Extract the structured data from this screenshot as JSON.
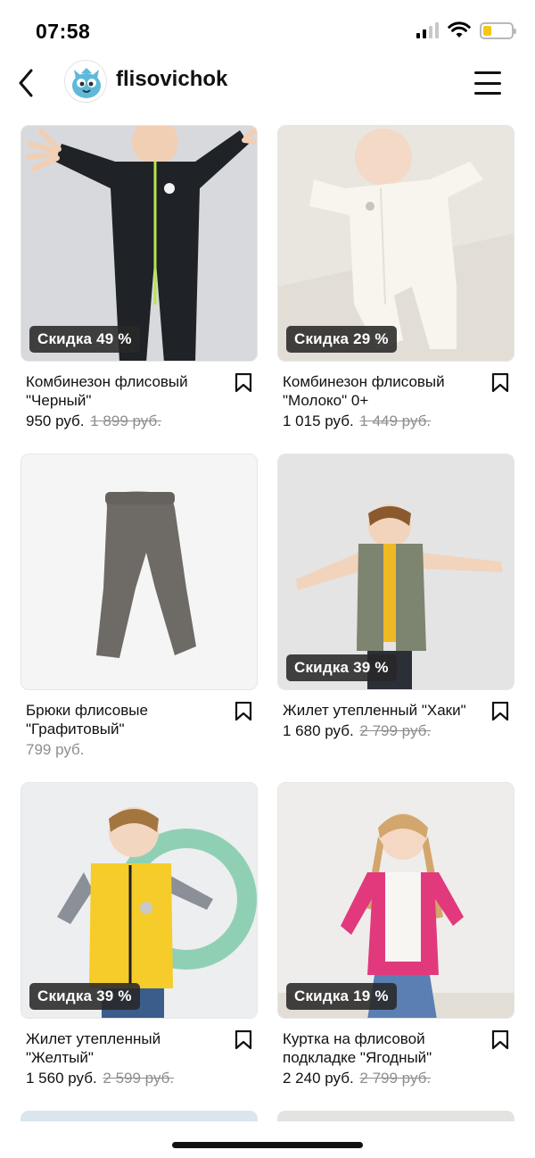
{
  "status": {
    "time": "07:58"
  },
  "header": {
    "username": "flisovichok"
  },
  "products": [
    {
      "name": "Комбинезон флисовый \"Черный\"",
      "price": "950 руб.",
      "old_price": "1 899 руб.",
      "discount": "Скидка 49 %"
    },
    {
      "name": "Комбинезон флисовый \"Молоко\" 0+",
      "price": "1 015 руб.",
      "old_price": "1 449 руб.",
      "discount": "Скидка 29 %"
    },
    {
      "name": "Брюки флисовые \"Графитовый\"",
      "price": "799 руб.",
      "old_price": "",
      "discount": ""
    },
    {
      "name": "Жилет утепленный \"Хаки\"",
      "price": "1 680 руб.",
      "old_price": "2 799 руб.",
      "discount": "Скидка 39 %"
    },
    {
      "name": "Жилет утепленный \"Желтый\"",
      "price": "1 560 руб.",
      "old_price": "2 599 руб.",
      "discount": "Скидка 39 %"
    },
    {
      "name": "Куртка на флисовой подкладке \"Ягодный\"",
      "price": "2 240 руб.",
      "old_price": "2 799 руб.",
      "discount": "Скидка 19 %"
    }
  ],
  "icons": {
    "back": "chevron-left-icon",
    "menu": "hamburger-menu-icon",
    "bookmark": "bookmark-icon",
    "wifi": "wifi-icon",
    "battery": "battery-icon",
    "signal": "signal-icon"
  },
  "colors": {
    "battery_fill": "#f5c518",
    "badge_bg": "#282828"
  }
}
